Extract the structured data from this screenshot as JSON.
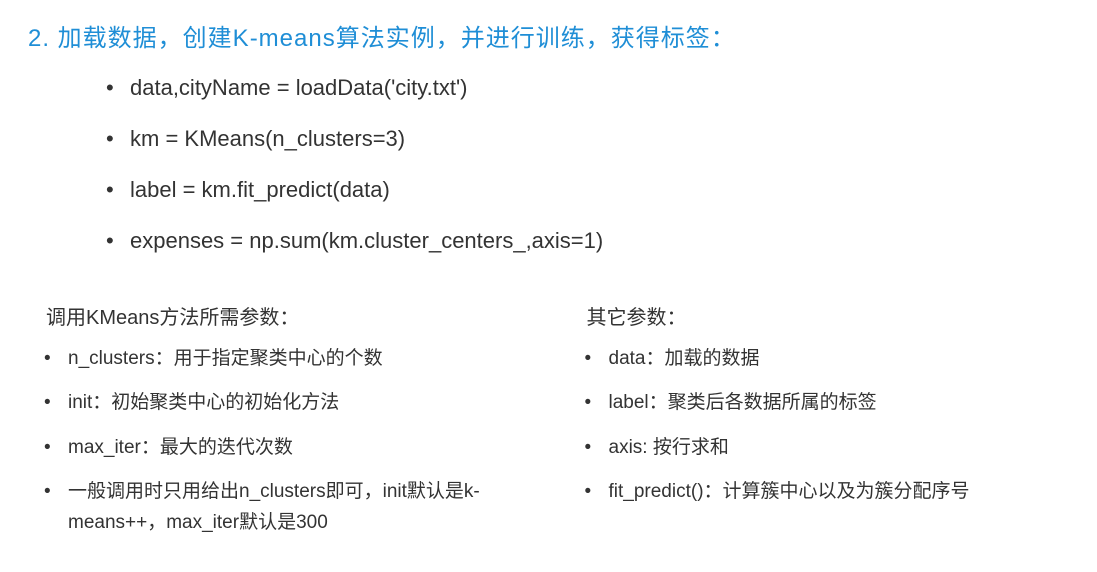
{
  "heading": "2. 加载数据，创建K-means算法实例，并进行训练，获得标签：",
  "code_lines": [
    "data,cityName = loadData('city.txt')",
    "km = KMeans(n_clusters=3)",
    "label = km.fit_predict(data)",
    "expenses = np.sum(km.cluster_centers_,axis=1)"
  ],
  "left_col": {
    "title": "调用KMeans方法所需参数：",
    "items": [
      "n_clusters：用于指定聚类中心的个数",
      "init：初始聚类中心的初始化方法",
      "max_iter：最大的迭代次数",
      "一般调用时只用给出n_clusters即可，init默认是k-means++，max_iter默认是300"
    ]
  },
  "right_col": {
    "title": "其它参数：",
    "items": [
      "data：加载的数据",
      "label：聚类后各数据所属的标签",
      "axis: 按行求和",
      "fit_predict()：计算簇中心以及为簇分配序号"
    ]
  }
}
